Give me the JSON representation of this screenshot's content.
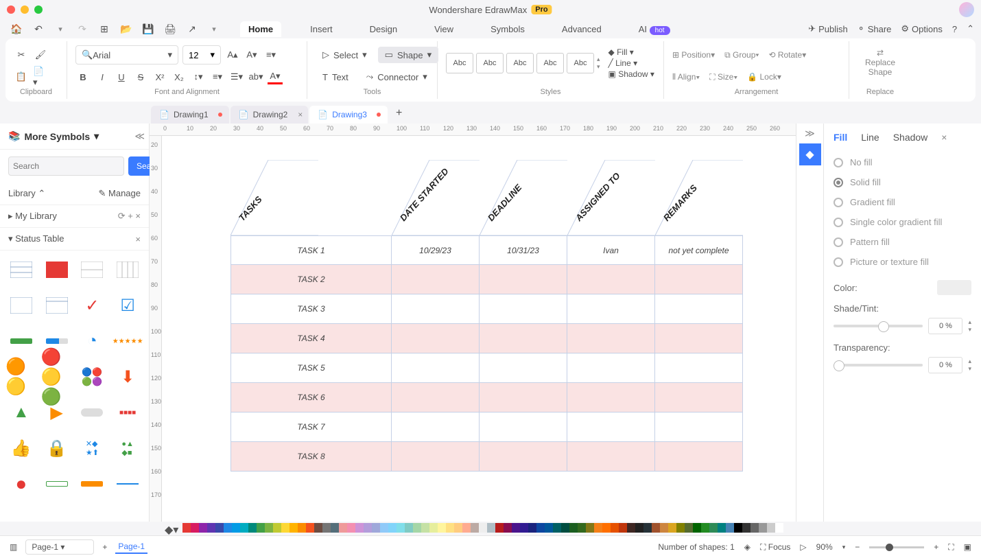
{
  "app": {
    "title": "Wondershare EdrawMax",
    "badge": "Pro"
  },
  "menu": {
    "tabs": [
      "Home",
      "Insert",
      "Design",
      "View",
      "Symbols",
      "Advanced",
      "AI"
    ],
    "active": "Home",
    "hot": "hot",
    "right": {
      "publish": "Publish",
      "share": "Share",
      "options": "Options"
    }
  },
  "ribbon": {
    "font": "Arial",
    "size": "12",
    "groups": {
      "clipboard": "Clipboard",
      "font": "Font and Alignment",
      "tools": "Tools",
      "styles": "Styles",
      "arrange": "Arrangement",
      "replace": "Replace"
    },
    "tools": {
      "select": "Select",
      "shape": "Shape",
      "text": "Text",
      "connector": "Connector"
    },
    "gallery": "Abc",
    "style": {
      "fill": "Fill",
      "line": "Line",
      "shadow": "Shadow"
    },
    "arrange": {
      "position": "Position",
      "align": "Align",
      "group": "Group",
      "size": "Size",
      "rotate": "Rotate",
      "lock": "Lock"
    },
    "replace_shape": "Replace\nShape"
  },
  "docs": [
    {
      "name": "Drawing1",
      "modified": true,
      "active": false
    },
    {
      "name": "Drawing2",
      "modified": false,
      "active": false,
      "closable": true
    },
    {
      "name": "Drawing3",
      "modified": true,
      "active": true
    }
  ],
  "sidebar": {
    "title": "More Symbols",
    "search_ph": "Search",
    "search_btn": "Search",
    "library": "Library",
    "manage": "Manage",
    "mylib": "My Library",
    "section": "Status Table"
  },
  "ruler_h": [
    "0",
    "10",
    "20",
    "30",
    "40",
    "50",
    "60",
    "70",
    "80",
    "90",
    "100",
    "110",
    "120",
    "130",
    "140",
    "150",
    "160",
    "170",
    "180",
    "190",
    "200",
    "210",
    "220",
    "230",
    "240",
    "250",
    "260"
  ],
  "ruler_v": [
    "20",
    "30",
    "40",
    "50",
    "60",
    "70",
    "80",
    "90",
    "100",
    "110",
    "120",
    "130",
    "140",
    "150",
    "160",
    "170"
  ],
  "table": {
    "headers": [
      "TASKS",
      "DATE STARTED",
      "DEADLINE",
      "ASSIGNED TO",
      "REMARKS"
    ],
    "rows": [
      {
        "task": "TASK 1",
        "started": "10/29/23",
        "deadline": "10/31/23",
        "assigned": "Ivan",
        "remarks": "not yet complete"
      },
      {
        "task": "TASK 2",
        "started": "",
        "deadline": "",
        "assigned": "",
        "remarks": ""
      },
      {
        "task": "TASK 3",
        "started": "",
        "deadline": "",
        "assigned": "",
        "remarks": ""
      },
      {
        "task": "TASK 4",
        "started": "",
        "deadline": "",
        "assigned": "",
        "remarks": ""
      },
      {
        "task": "TASK 5",
        "started": "",
        "deadline": "",
        "assigned": "",
        "remarks": ""
      },
      {
        "task": "TASK 6",
        "started": "",
        "deadline": "",
        "assigned": "",
        "remarks": ""
      },
      {
        "task": "TASK 7",
        "started": "",
        "deadline": "",
        "assigned": "",
        "remarks": ""
      },
      {
        "task": "TASK 8",
        "started": "",
        "deadline": "",
        "assigned": "",
        "remarks": ""
      }
    ]
  },
  "panel": {
    "tabs": {
      "fill": "Fill",
      "line": "Line",
      "shadow": "Shadow"
    },
    "fills": [
      "No fill",
      "Solid fill",
      "Gradient fill",
      "Single color gradient fill",
      "Pattern fill",
      "Picture or texture fill"
    ],
    "fill_sel": 1,
    "color": "Color:",
    "shade": "Shade/Tint:",
    "trans": "Transparency:",
    "shade_val": "0 %",
    "trans_val": "0 %"
  },
  "status": {
    "page": "Page-1",
    "page_tab": "Page-1",
    "shapes": "Number of shapes: 1",
    "focus": "Focus",
    "zoom": "90%"
  },
  "colors": [
    "#e53935",
    "#d81b60",
    "#8e24aa",
    "#5e35b1",
    "#3949ab",
    "#1e88e5",
    "#039be5",
    "#00acc1",
    "#00897b",
    "#43a047",
    "#7cb342",
    "#c0ca33",
    "#fdd835",
    "#ffb300",
    "#fb8c00",
    "#f4511e",
    "#6d4c41",
    "#757575",
    "#546e7a",
    "#ef9a9a",
    "#f48fb1",
    "#ce93d8",
    "#b39ddb",
    "#9fa8da",
    "#90caf9",
    "#81d4fa",
    "#80deea",
    "#80cbc4",
    "#a5d6a7",
    "#c5e1a5",
    "#e6ee9c",
    "#fff59d",
    "#ffe082",
    "#ffcc80",
    "#ffab91",
    "#bcaaa4",
    "#eeeeee",
    "#b0bec5",
    "#b71c1c",
    "#880e4f",
    "#4a148c",
    "#311b92",
    "#1a237e",
    "#0d47a1",
    "#01579b",
    "#006064",
    "#004d40",
    "#1b5e20",
    "#33691e",
    "#827717",
    "#f57f17",
    "#ff6f00",
    "#e65100",
    "#bf360c",
    "#3e2723",
    "#212121",
    "#263238",
    "#a0522d",
    "#cd853f",
    "#daa520",
    "#808000",
    "#556b2f",
    "#006400",
    "#228b22",
    "#2e8b57",
    "#008080",
    "#4682b4",
    "#000000",
    "#333333",
    "#666666",
    "#999999",
    "#cccccc",
    "#ffffff"
  ]
}
